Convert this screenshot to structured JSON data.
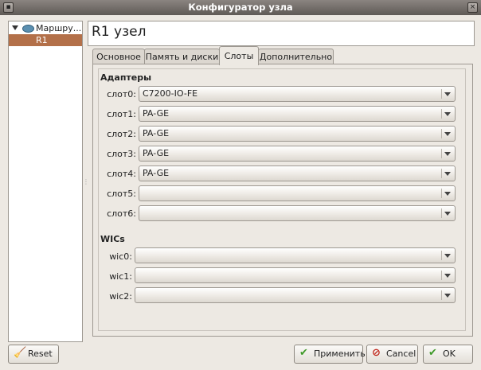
{
  "window": {
    "title": "Конфигуратор узла"
  },
  "tree": {
    "parent_label": "Маршру...",
    "child_label": "R1"
  },
  "node_title": "R1 узел",
  "tabs": [
    "Основное",
    "Память и диски",
    "Слоты",
    "Дополнительно"
  ],
  "active_tab": "Слоты",
  "adapters": {
    "title": "Адаптеры",
    "slots": [
      {
        "label": "слот0:",
        "value": "C7200-IO-FE"
      },
      {
        "label": "слот1:",
        "value": "PA-GE"
      },
      {
        "label": "слот2:",
        "value": "PA-GE"
      },
      {
        "label": "слот3:",
        "value": "PA-GE"
      },
      {
        "label": "слот4:",
        "value": "PA-GE"
      },
      {
        "label": "слот5:",
        "value": ""
      },
      {
        "label": "слот6:",
        "value": ""
      }
    ]
  },
  "wics": {
    "title": "WICs",
    "slots": [
      {
        "label": "wic0:",
        "value": ""
      },
      {
        "label": "wic1:",
        "value": ""
      },
      {
        "label": "wic2:",
        "value": ""
      }
    ]
  },
  "buttons": {
    "reset": "Reset",
    "apply": "Применить",
    "cancel": "Cancel",
    "ok": "OK"
  }
}
